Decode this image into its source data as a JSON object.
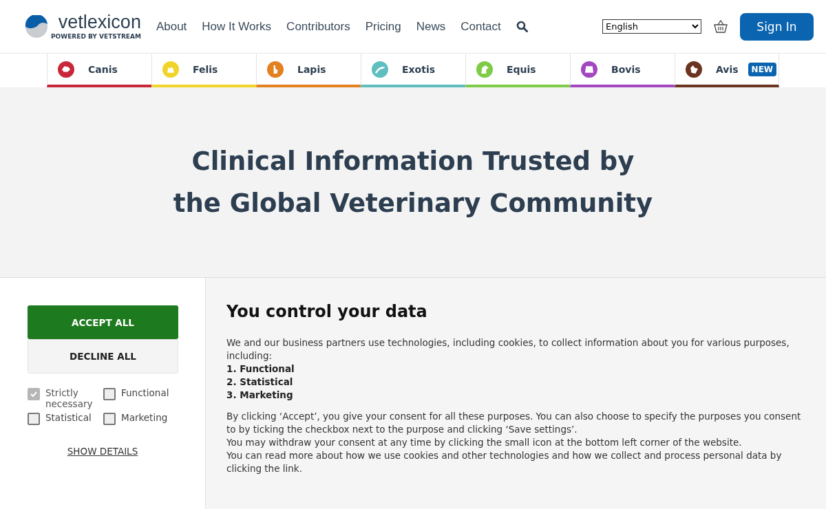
{
  "header": {
    "logo": {
      "name": "vetlexicon",
      "tagline": "POWERED BY VETSTREAM"
    },
    "nav": [
      "About",
      "How It Works",
      "Contributors",
      "Pricing",
      "News",
      "Contact"
    ],
    "language": "English",
    "sign_in": "Sign In"
  },
  "species": [
    {
      "label": "Canis",
      "color": "#c8273a"
    },
    {
      "label": "Felis",
      "color": "#f0d42a"
    },
    {
      "label": "Lapis",
      "color": "#e3801f"
    },
    {
      "label": "Exotis",
      "color": "#5fbfc0"
    },
    {
      "label": "Equis",
      "color": "#7ecb46"
    },
    {
      "label": "Bovis",
      "color": "#a347c0"
    },
    {
      "label": "Avis",
      "color": "#6b3420",
      "badge": "NEW"
    }
  ],
  "hero": {
    "title": "Clinical Information Trusted by the Global Veterinary Community"
  },
  "consent": {
    "accept": "ACCEPT ALL",
    "decline": "DECLINE ALL",
    "options": [
      {
        "label": "Strictly necessary",
        "checked": true,
        "disabled": true
      },
      {
        "label": "Functional",
        "checked": false,
        "disabled": false
      },
      {
        "label": "Statistical",
        "checked": false,
        "disabled": false
      },
      {
        "label": "Marketing",
        "checked": false,
        "disabled": false
      }
    ],
    "details": "SHOW DETAILS",
    "heading": "You control your data",
    "intro": "We and our business partners use technologies, including cookies, to collect information about you for various purposes, including:",
    "purposes": [
      "1. Functional",
      "2. Statistical",
      "3. Marketing"
    ],
    "paragraphs": [
      "By clicking ‘Accept’, you give your consent for all these purposes. You can also choose to specify the purposes you consent to by ticking the checkbox next to the purpose and clicking ‘Save settings’.",
      "You may withdraw your consent at any time by clicking the small icon at the bottom left corner of the website.",
      "You can read more about how we use cookies and other technologies and how we collect and process personal data by clicking the link."
    ]
  }
}
